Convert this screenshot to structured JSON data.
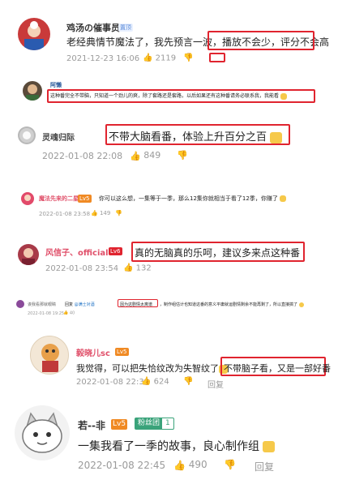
{
  "colors": {
    "accent_red": "#e0242f",
    "meta_gray": "#9a9a9a",
    "name_blue": "#2b5b9c",
    "name_pink": "#e0506a",
    "badge_orange": "#f08a24"
  },
  "c1": {
    "name": "鸡汤の催事员",
    "tag": "置顶",
    "text_a": "老经典情节魔法了，我先预言一波，",
    "text_b": "播放不会少，评分不会高",
    "time": "2021-12-23 16:06",
    "likes": "2119"
  },
  "c2": {
    "name": "阿懒",
    "text": "这种番完全不带脑，只知道一个劲儿的爽，除了套路还是套路，以后如果还有这种番请务必联系我，我能看"
  },
  "c3": {
    "name": "灵魂归际",
    "text": "不带大脑看番，体验上升百分之百",
    "time": "2022-01-08 22:08",
    "likes": "849"
  },
  "c4": {
    "name": "魔法先来的二星",
    "badge": "Lv5",
    "text": "你可以这么想，一集等于一季，那么12集你就相当于看了12季，你赚了",
    "time": "2022-01-08 23:58",
    "likes": "149"
  },
  "c5": {
    "name": "风信子、official",
    "badge": "Lv6",
    "text": "真的无脑真的乐呵，建议多来点这种番",
    "time": "2022-01-08 23:54",
    "likes": "132"
  },
  "c6": {
    "name": "诶我看那就眼睛",
    "reply": "回复",
    "mention": "@满士对酒",
    "text_box": "因为这剧情太离谱",
    "text_rest": "，制作组估计也知道这番的意义平庸就运剧情剩余不能再剩了，所以直接搞了",
    "time": "2022-01-08 19:25",
    "likes": "40"
  },
  "c7": {
    "name": "毅晓儿sc",
    "badge": "Lv5",
    "text_a": "我觉得，可以把失恰纹改为失智纹了",
    "text_b": "不带脑子看，又是一部好番",
    "time": "2022-01-08 22:30",
    "likes": "624",
    "reply": "回复"
  },
  "c8": {
    "name": "若--非",
    "badge": "Lv5",
    "fan": "粉丝团",
    "fan_level": "1",
    "text": "一集我看了一季的故事，良心制作组",
    "time": "2022-01-08 22:45",
    "likes": "490",
    "reply": "回复"
  }
}
